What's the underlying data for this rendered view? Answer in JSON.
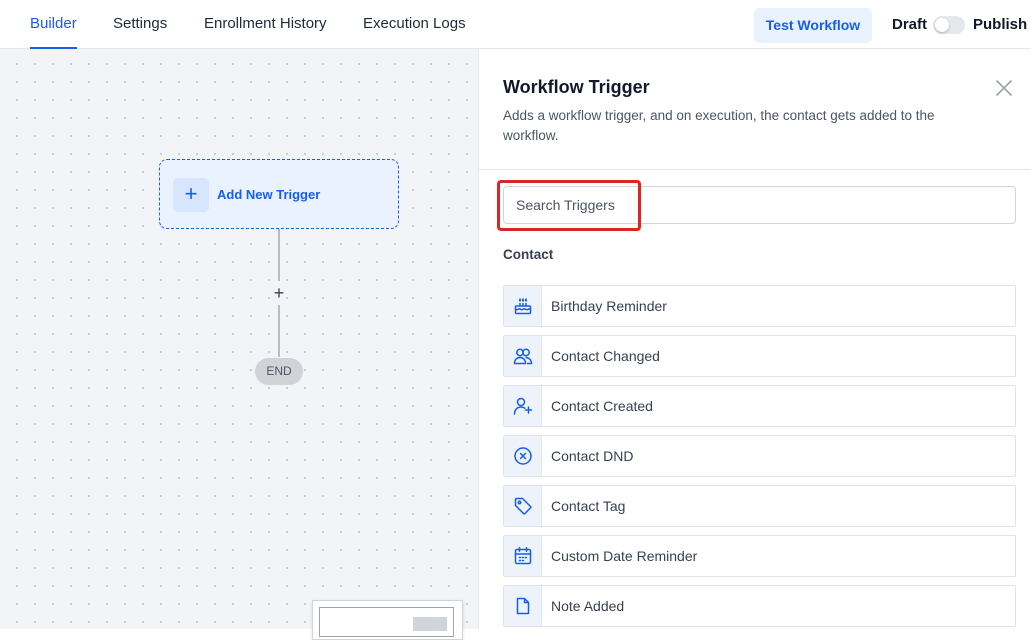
{
  "nav": {
    "tabs": [
      {
        "label": "Builder",
        "active": true
      },
      {
        "label": "Settings",
        "active": false
      },
      {
        "label": "Enrollment History",
        "active": false
      },
      {
        "label": "Execution Logs",
        "active": false
      }
    ],
    "test_button": "Test Workflow",
    "draft_label": "Draft",
    "publish_label": "Publish",
    "publish_toggle_on": false
  },
  "canvas": {
    "trigger_node": {
      "icon": "plus-icon",
      "label": "Add New Trigger"
    },
    "add_step_symbol": "+",
    "end_label": "END"
  },
  "panel": {
    "title": "Workflow Trigger",
    "description": "Adds a workflow trigger, and on execution, the contact gets added to the workflow.",
    "search_placeholder": "Search Triggers",
    "search_value": "",
    "section": "Contact",
    "items": [
      {
        "label": "Birthday Reminder",
        "icon": "cake-icon"
      },
      {
        "label": "Contact Changed",
        "icon": "users-icon"
      },
      {
        "label": "Contact Created",
        "icon": "user-plus-icon"
      },
      {
        "label": "Contact DND",
        "icon": "x-circle-icon"
      },
      {
        "label": "Contact Tag",
        "icon": "tag-icon"
      },
      {
        "label": "Custom Date Reminder",
        "icon": "calendar-icon"
      },
      {
        "label": "Note Added",
        "icon": "document-icon"
      }
    ]
  },
  "colors": {
    "accent": "#155eef",
    "accent_light": "#eaf2ff",
    "highlight": "#dc2626"
  }
}
